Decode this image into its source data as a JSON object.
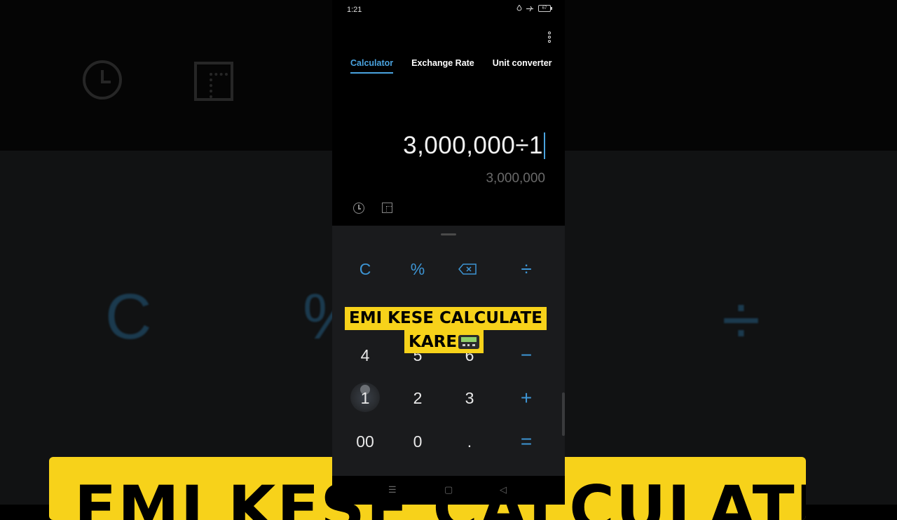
{
  "status_bar": {
    "time": "1:21",
    "battery": "67"
  },
  "tabs": [
    {
      "label": "Calculator",
      "active": true
    },
    {
      "label": "Exchange Rate",
      "active": false
    },
    {
      "label": "Unit converter",
      "active": false
    }
  ],
  "display": {
    "expression": "3,000,000÷1",
    "result": "3,000,000"
  },
  "keys": {
    "clear": "C",
    "percent": "%",
    "divide": "÷",
    "four": "4",
    "five": "5",
    "six": "6",
    "minus": "−",
    "one": "1",
    "two": "2",
    "three": "3",
    "plus": "+",
    "double_zero": "00",
    "zero": "0",
    "decimal": ".",
    "equals": "="
  },
  "nav_bar": {
    "menu": "☰",
    "home": "▢",
    "back": "◁"
  },
  "caption": {
    "line1": "EMI KESE CALCULATE",
    "line2": "KARE"
  },
  "background_copy": {
    "clear": "C",
    "percent": "%",
    "divide": "÷",
    "banner": "EMI KESE CALCULATE"
  },
  "colors": {
    "accent": "#3d95d4",
    "caption_bg": "#f7d21a",
    "keypad_bg": "#1a1b1d"
  }
}
